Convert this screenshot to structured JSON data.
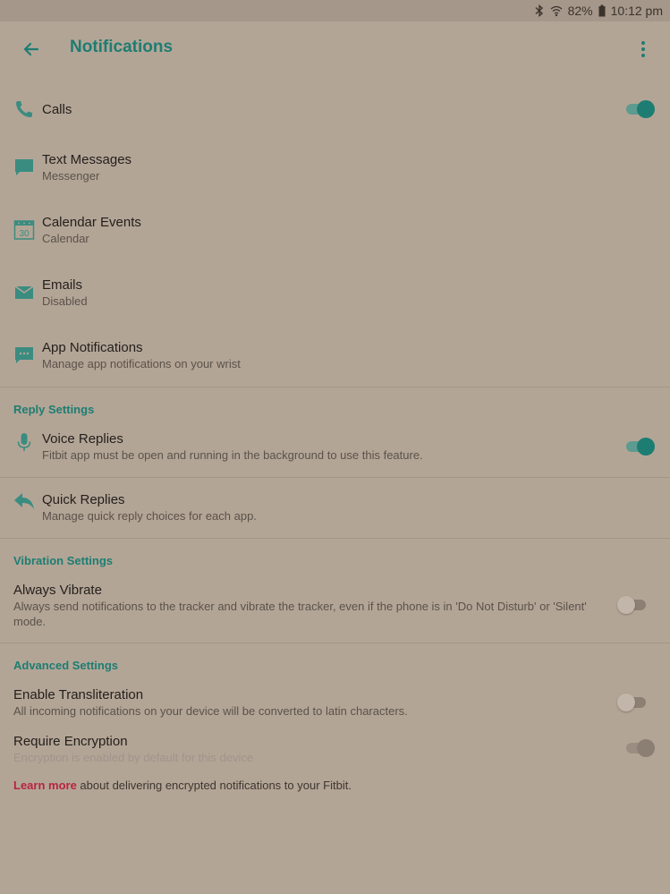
{
  "status": {
    "battery": "82%",
    "time": "10:12 pm"
  },
  "header": {
    "title": "Notifications"
  },
  "notifications": [
    {
      "label": "Calls",
      "sub": ""
    },
    {
      "label": "Text Messages",
      "sub": "Messenger"
    },
    {
      "label": "Calendar Events",
      "sub": "Calendar",
      "icon_text": "30"
    },
    {
      "label": "Emails",
      "sub": "Disabled"
    },
    {
      "label": "App Notifications",
      "sub": "Manage app notifications on your wrist"
    }
  ],
  "reply_settings": {
    "heading": "Reply Settings",
    "voice": {
      "label": "Voice Replies",
      "sub": "Fitbit app must be open and running in the background to use this feature."
    },
    "quick": {
      "label": "Quick Replies",
      "sub": "Manage quick reply choices for each app."
    }
  },
  "vibration_settings": {
    "heading": "Vibration Settings",
    "always": {
      "label": "Always Vibrate",
      "sub": "Always send notifications to the tracker and vibrate the tracker, even if the phone is in 'Do Not Disturb' or 'Silent' mode."
    }
  },
  "advanced_settings": {
    "heading": "Advanced Settings",
    "transliteration": {
      "label": "Enable Transliteration",
      "sub": "All incoming notifications on your device will be converted to latin characters."
    },
    "encryption": {
      "label": "Require Encryption",
      "sub": "Encryption is enabled by default for this device"
    }
  },
  "learn_more": {
    "link": "Learn more",
    "rest": " about delivering encrypted notifications to your Fitbit."
  },
  "toggles": {
    "calls": true,
    "voice_replies": true,
    "always_vibrate": false,
    "transliteration": false,
    "encryption": true
  },
  "colors": {
    "accent": "#1d7d72",
    "link": "#b8243e",
    "background": "#b3a596"
  },
  "icons": {
    "back": "arrow-left-icon",
    "more": "more-vertical-icon",
    "calls": "phone-icon",
    "text": "chat-bubble-icon",
    "calendar": "calendar-icon",
    "email": "envelope-icon",
    "apps": "app-message-icon",
    "voice": "microphone-icon",
    "quick": "reply-icon"
  }
}
